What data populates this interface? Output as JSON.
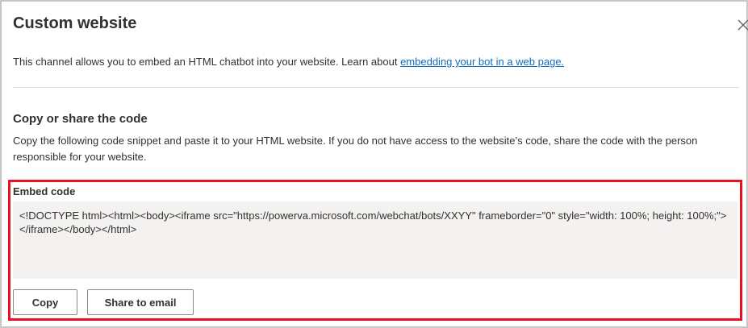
{
  "dialog": {
    "title": "Custom website",
    "close_icon": "close-icon"
  },
  "intro": {
    "text": "This channel allows you to embed an HTML chatbot into your website. Learn about ",
    "link_text": "embedding your bot in a web page."
  },
  "section": {
    "title": "Copy or share the code",
    "description": "Copy the following code snippet and paste it to your HTML website. If you do not have access to the website’s code, share the code with the person responsible for your website."
  },
  "embed": {
    "label": "Embed code",
    "code": "<!DOCTYPE html><html><body><iframe src=\"https://powerva.microsoft.com/webchat/bots/XXYY\" frameborder=\"0\" style=\"width: 100%; height: 100%;\"></iframe></body></html>"
  },
  "buttons": {
    "copy": "Copy",
    "share": "Share to email"
  },
  "colors": {
    "link": "#0f6cbd",
    "highlight_border": "#e81123",
    "code_background": "#f3f2f1"
  }
}
